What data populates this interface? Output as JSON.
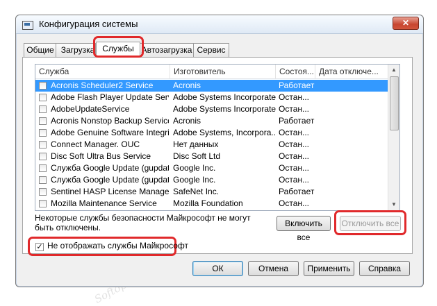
{
  "window": {
    "title": "Конфигурация системы",
    "close_glyph": "✕"
  },
  "tabs": [
    {
      "label": "Общие",
      "active": false
    },
    {
      "label": "Загрузка",
      "active": false
    },
    {
      "label": "Службы",
      "active": true
    },
    {
      "label": "Автозагрузка",
      "active": false
    },
    {
      "label": "Сервис",
      "active": false
    }
  ],
  "list": {
    "headers": [
      "Служба",
      "Изготовитель",
      "Состоя...",
      "Дата отключе..."
    ],
    "rows": [
      {
        "service": "Acronis Scheduler2 Service",
        "vendor": "Acronis",
        "status": "Работает",
        "selected": true
      },
      {
        "service": "Adobe Flash Player Update Service",
        "vendor": "Adobe Systems Incorporated",
        "status": "Остан...",
        "selected": false
      },
      {
        "service": "AdobeUpdateService",
        "vendor": "Adobe Systems Incorporated",
        "status": "Остан...",
        "selected": false
      },
      {
        "service": "Acronis Nonstop Backup Service",
        "vendor": "Acronis",
        "status": "Работает",
        "selected": false
      },
      {
        "service": "Adobe Genuine Software Integri...",
        "vendor": "Adobe Systems, Incorpora...",
        "status": "Остан...",
        "selected": false
      },
      {
        "service": "Connect Manager. OUC",
        "vendor": "Нет данных",
        "status": "Остан...",
        "selected": false
      },
      {
        "service": "Disc Soft Ultra Bus Service",
        "vendor": "Disc Soft Ltd",
        "status": "Остан...",
        "selected": false
      },
      {
        "service": "Служба Google Update (gupdate)",
        "vendor": "Google Inc.",
        "status": "Остан...",
        "selected": false
      },
      {
        "service": "Служба Google Update (gupdatem)",
        "vendor": "Google Inc.",
        "status": "Остан...",
        "selected": false
      },
      {
        "service": "Sentinel HASP License Manager",
        "vendor": "SafeNet Inc.",
        "status": "Работает",
        "selected": false
      },
      {
        "service": "Mozilla Maintenance Service",
        "vendor": "Mozilla Foundation",
        "status": "Остан...",
        "selected": false
      }
    ]
  },
  "note": "Некоторые службы безопасности Майкрософт не могут быть отключены.",
  "buttons": {
    "enable_all": "Включить все",
    "disable_all": "Отключить все",
    "ok": "ОК",
    "cancel": "Отмена",
    "apply": "Применить",
    "help": "Справка"
  },
  "hide_microsoft": {
    "label": "Не отображать службы Майкрософт",
    "checked": true
  },
  "watermark": "Softoportal.com",
  "colors": {
    "highlight": "#e0292b",
    "selection": "#3399ff"
  }
}
